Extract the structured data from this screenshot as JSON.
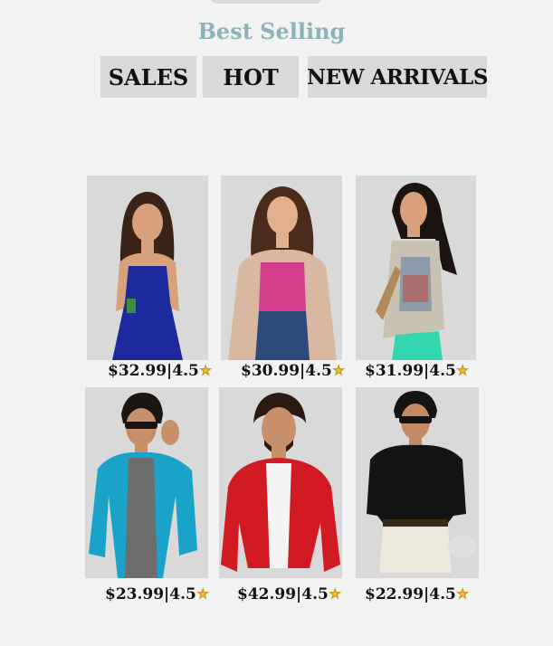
{
  "header": {
    "title": "Best Selling"
  },
  "tabs": [
    {
      "label": "SALES"
    },
    {
      "label": "HOT"
    },
    {
      "label": "NEW ARRIVALS"
    }
  ],
  "products": [
    {
      "price": "$32.99|4.5",
      "image": "woman-blue-dress",
      "colors": {
        "garment": "#1c2a9e",
        "hair": "#3a2418",
        "skin": "#d9a07c"
      }
    },
    {
      "price": "$30.99|4.5",
      "image": "woman-pink-top",
      "colors": {
        "garment": "#d43c8c",
        "hair": "#4a2a18",
        "skin": "#e2b08c"
      }
    },
    {
      "price": "$31.99|4.5",
      "image": "woman-printed-kurti",
      "colors": {
        "garment": "#c9c2b0",
        "hair": "#1b1410",
        "skin": "#d9a07c"
      }
    },
    {
      "price": "$23.99|4.5",
      "image": "man-blue-jacket",
      "colors": {
        "garment": "#1aa3c8",
        "hair": "#1b1410",
        "skin": "#c8906a"
      }
    },
    {
      "price": "$42.99|4.5",
      "image": "man-red-blazer",
      "colors": {
        "garment": "#d11a24",
        "hair": "#2a1a10",
        "skin": "#c8906a"
      }
    },
    {
      "price": "$22.99|4.5",
      "image": "man-black-shirt",
      "colors": {
        "garment": "#141414",
        "hair": "#141414",
        "skin": "#c48a66"
      }
    }
  ],
  "icons": {
    "rating": "star-icon"
  }
}
